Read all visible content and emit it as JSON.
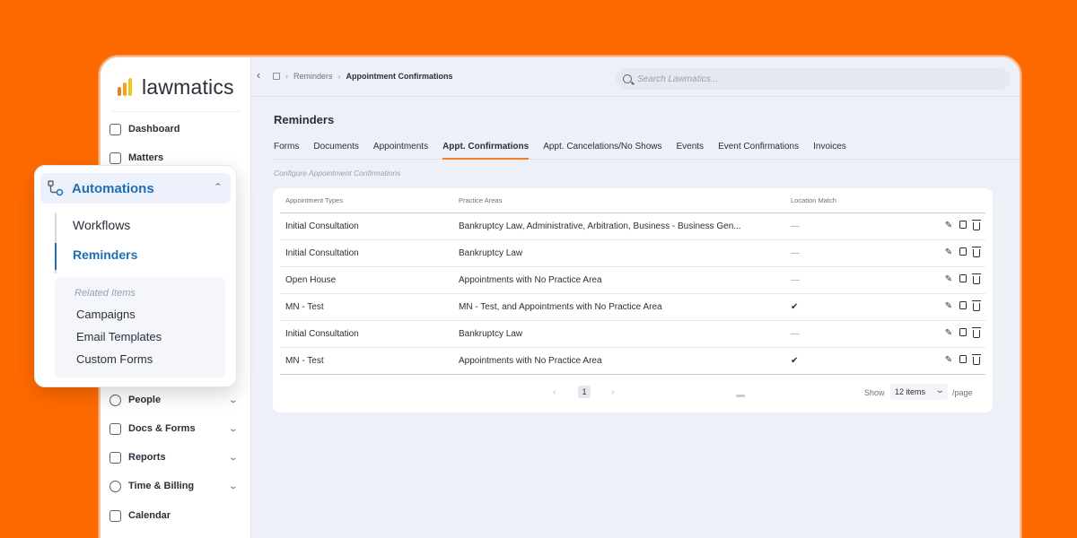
{
  "brand": {
    "name": "lawmatics",
    "bar_colors": [
      "#f07d2a",
      "#f7a21b",
      "#f0c419"
    ]
  },
  "sidebar": {
    "items": [
      {
        "label": "Dashboard",
        "icon": "dashboard-icon"
      },
      {
        "label": "Matters",
        "icon": "matters-icon"
      },
      {
        "label": "People",
        "icon": "people-icon"
      },
      {
        "label": "Docs & Forms",
        "icon": "docs-forms-icon"
      },
      {
        "label": "Reports",
        "icon": "reports-icon"
      },
      {
        "label": "Time & Billing",
        "icon": "time-billing-icon"
      },
      {
        "label": "Calendar",
        "icon": "calendar-icon"
      }
    ]
  },
  "automations_menu": {
    "label": "Automations",
    "icon": "automations-icon",
    "sub_items": [
      "Workflows",
      "Reminders"
    ],
    "active_sub": "Reminders",
    "related_title": "Related Items",
    "related_items": [
      "Campaigns",
      "Email Templates",
      "Custom Forms"
    ]
  },
  "topbar": {
    "collapse_glyph": "‹",
    "breadcrumb": [
      "Reminders",
      "Appointment Confirmations"
    ],
    "search_placeholder": "Search Lawmatics..."
  },
  "page": {
    "title": "Reminders",
    "tabs": [
      "Forms",
      "Documents",
      "Appointments",
      "Appt. Confirmations",
      "Appt. Cancelations/No Shows",
      "Events",
      "Event Confirmations",
      "Invoices"
    ],
    "active_tab": "Appt. Confirmations",
    "subtitle": "Configure Appointment Confirmations"
  },
  "table": {
    "headers": [
      "Appointment Types",
      "Practice Areas",
      "Location Match"
    ],
    "rows": [
      {
        "type": "Initial Consultation",
        "areas": "Bankruptcy Law, Administrative, Arbitration, Business - Business Gen...",
        "location": "—"
      },
      {
        "type": "Initial Consultation",
        "areas": "Bankruptcy Law",
        "location": "—"
      },
      {
        "type": "Open House",
        "areas": "Appointments with No Practice Area",
        "location": "—"
      },
      {
        "type": "MN - Test",
        "areas": "MN - Test, and Appointments with No Practice Area",
        "location": "✔"
      },
      {
        "type": "Initial Consultation",
        "areas": "Bankruptcy Law",
        "location": "—"
      },
      {
        "type": "MN - Test",
        "areas": "Appointments with No Practice Area",
        "location": "✔"
      }
    ],
    "row_actions": [
      "edit-icon",
      "copy-icon",
      "trash-icon"
    ]
  },
  "pagination": {
    "current_page": "1",
    "show_label": "Show",
    "page_size": "12 items",
    "per_page_label": "/page"
  }
}
